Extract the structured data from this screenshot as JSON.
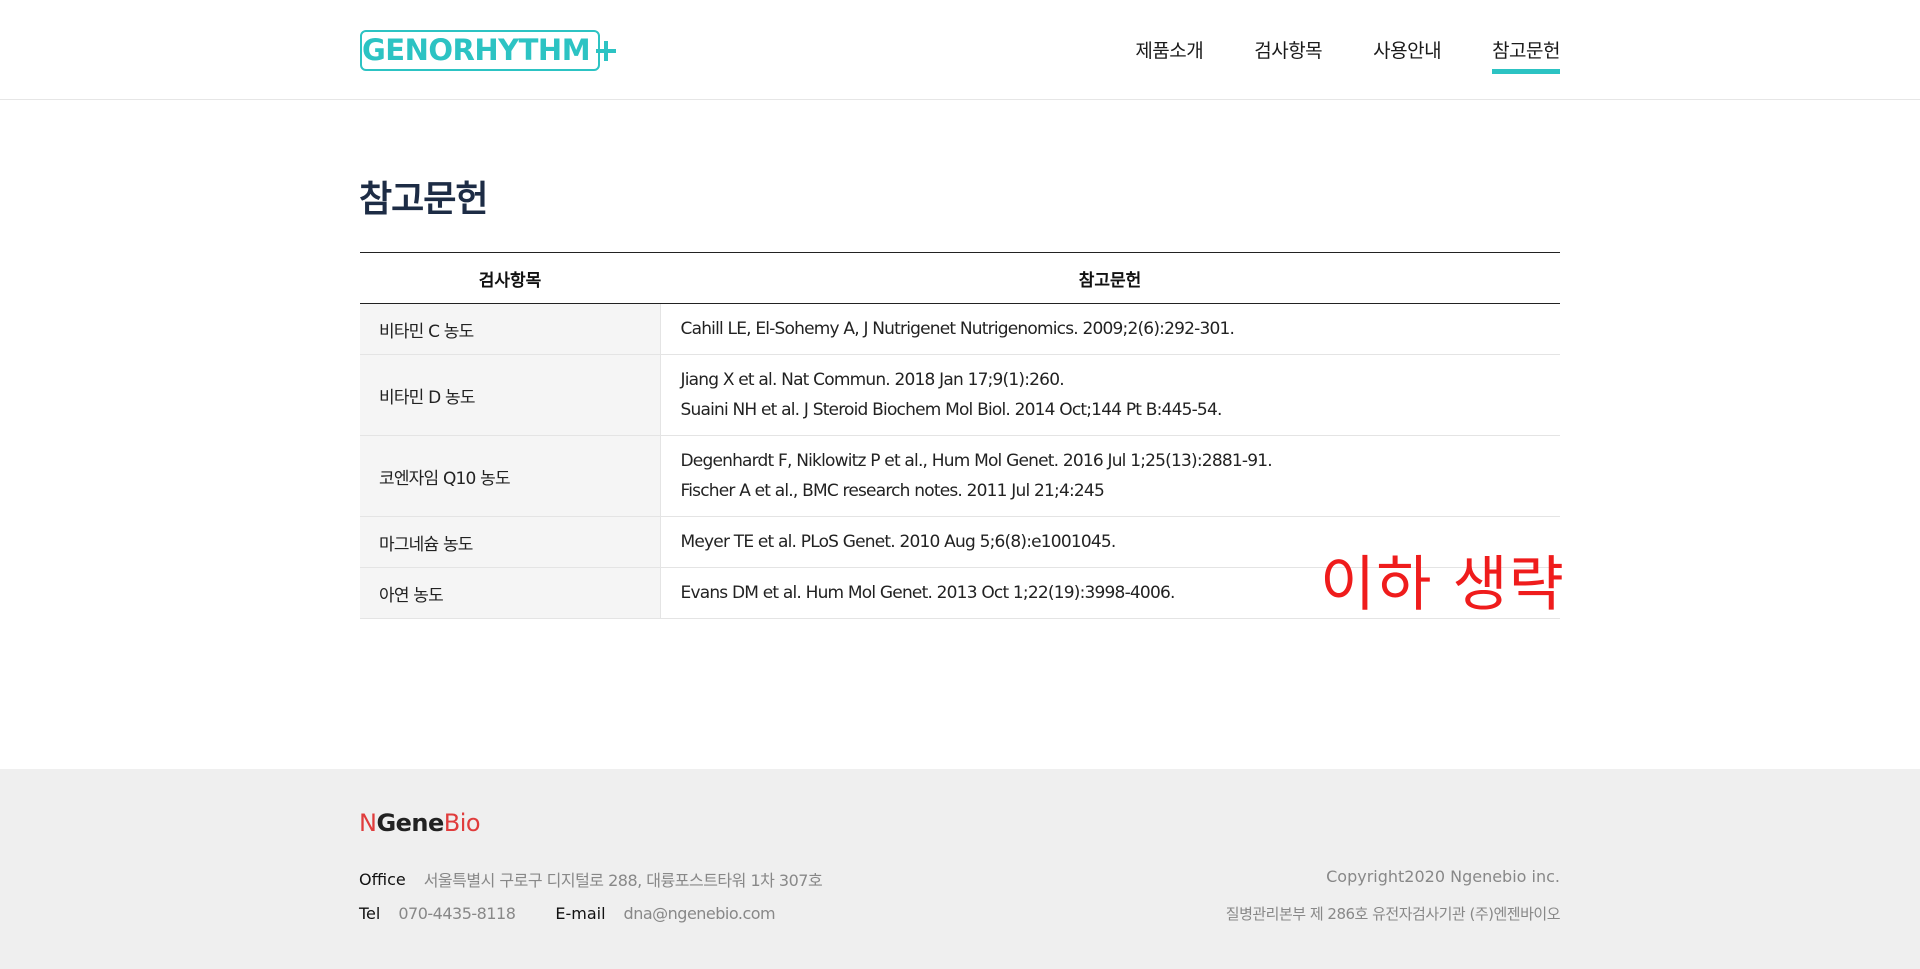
{
  "header": {
    "logo_text": "GENORHYTHM",
    "nav": [
      {
        "label": "제품소개"
      },
      {
        "label": "검사항목"
      },
      {
        "label": "사용안내"
      },
      {
        "label": "참고문헌"
      }
    ],
    "active_nav": "참고문헌",
    "accent_color": "#2cc3c3"
  },
  "main": {
    "title": "참고문헌",
    "table": {
      "headers": [
        "검사항목",
        "참고문헌"
      ],
      "rows": [
        {
          "item": "비타민 C 농도",
          "refs": [
            "Cahill LE, El-Sohemy A, J Nutrigenet Nutrigenomics. 2009;2(6):292-301."
          ]
        },
        {
          "item": "비타민 D 농도",
          "refs": [
            "Jiang X et al. Nat Commun. 2018 Jan 17;9(1):260.",
            "Suaini NH et al. J Steroid Biochem Mol Biol. 2014 Oct;144 Pt B:445-54."
          ]
        },
        {
          "item": "코엔자임 Q10 농도",
          "refs": [
            "Degenhardt F, Niklowitz P et al., Hum Mol Genet. 2016 Jul 1;25(13):2881-91.",
            "Fischer A et al., BMC research notes. 2011 Jul 21;4:245"
          ]
        },
        {
          "item": "마그네슘 농도",
          "refs": [
            "Meyer TE et al. PLoS Genet. 2010 Aug 5;6(8):e1001045."
          ]
        },
        {
          "item": "아연 농도",
          "refs": [
            "Evans DM et al. Hum Mol Genet. 2013 Oct 1;22(19):3998-4006."
          ]
        }
      ]
    },
    "omit_note": "이하 생략",
    "omit_note_color": "#ef1c1c"
  },
  "footer": {
    "logo": {
      "n": "N",
      "gene": "Gene",
      "bio": "Bio"
    },
    "office_label": "Office",
    "office_value": "서울특별시 구로구 디지털로 288, 대륭포스트타워 1차 307호",
    "tel_label": "Tel",
    "tel_value": "070-4435-8118",
    "email_label": "E-mail",
    "email_value": "dna@ngenebio.com",
    "copyright": "Copyright2020 Ngenebio inc.",
    "license": "질병관리본부 제 286호 유전자검사기관 (주)엔젠바이오"
  }
}
